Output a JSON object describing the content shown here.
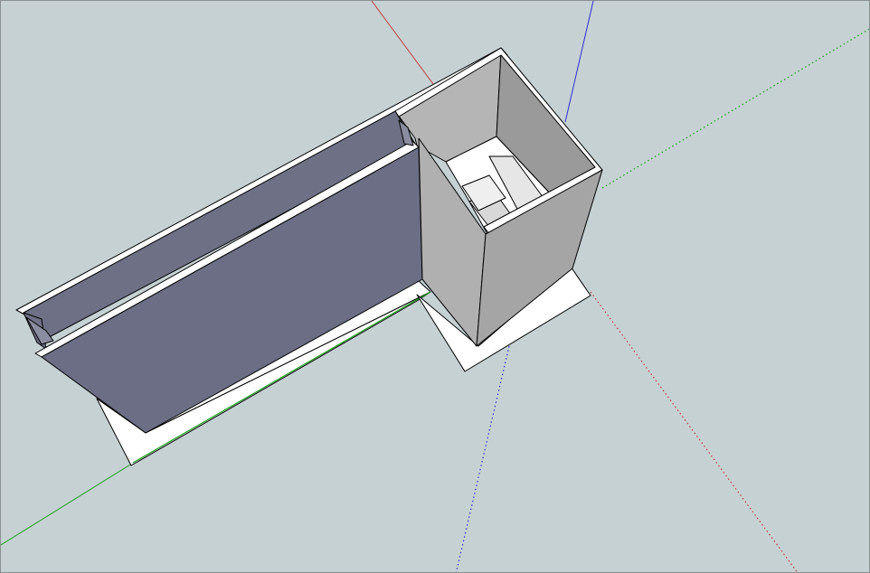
{
  "app": {
    "window_title": ""
  },
  "viewport": {
    "background_color": "#c6d1d3",
    "view": "3d-perspective"
  },
  "axes": {
    "red_color": "#c0383b",
    "green_color": "#1aa01a",
    "blue_color": "#2d2fcf",
    "positive_style": "solid",
    "negative_style": "dotted"
  },
  "model": {
    "description_visible": false,
    "colors": {
      "face_white": "#ffffff",
      "face_back_wall": "#6e7186",
      "face_inner_wall": "#6b6e84",
      "face_gray_light": "#b5b5b5",
      "face_gray_mid": "#a5a5a5",
      "face_gray_dark": "#9a9a9a",
      "edge": "#000000"
    }
  }
}
